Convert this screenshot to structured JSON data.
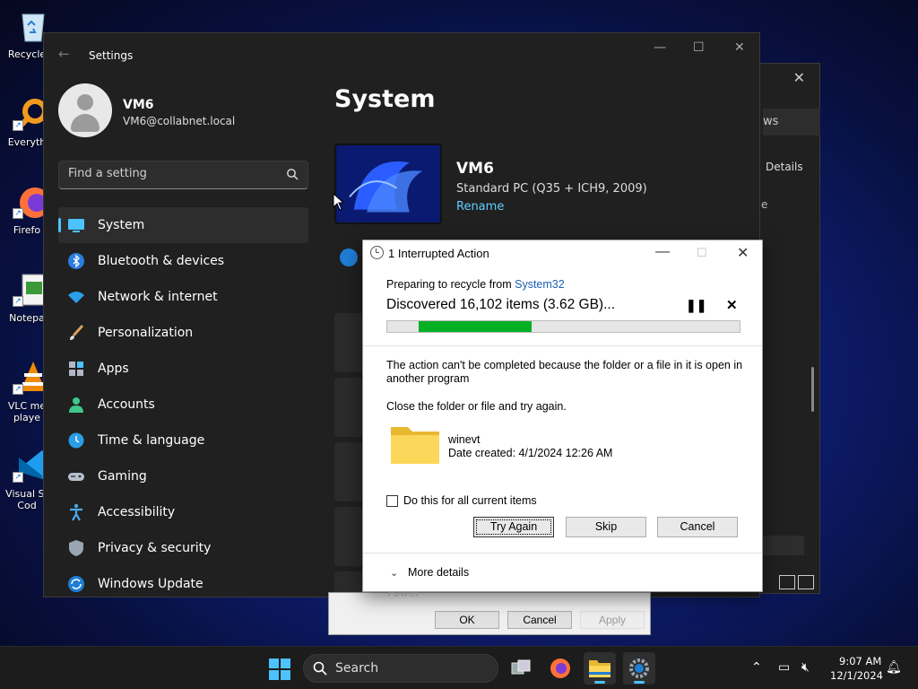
{
  "desktop": {
    "icons": [
      {
        "label": "Recycle",
        "icon": "recycle-bin-icon"
      },
      {
        "label": "Everyth",
        "icon": "everything-search-icon"
      },
      {
        "label": "Firefo",
        "icon": "firefox-icon"
      },
      {
        "label": "Notepa",
        "icon": "notepad-icon"
      },
      {
        "label": "VLC me\nplaye",
        "icon": "vlc-icon"
      },
      {
        "label": "Visual St\nCod",
        "icon": "vscode-icon"
      }
    ]
  },
  "bg_window": {
    "tab_label": "ws",
    "details_label": "Details",
    "partial_char": "e"
  },
  "settings": {
    "title": "Settings",
    "user": {
      "name": "VM6",
      "email": "VM6@collabnet.local"
    },
    "search_placeholder": "Find a setting",
    "nav": [
      {
        "label": "System",
        "icon": "monitor-icon",
        "active": true
      },
      {
        "label": "Bluetooth & devices",
        "icon": "bluetooth-icon"
      },
      {
        "label": "Network & internet",
        "icon": "wifi-icon"
      },
      {
        "label": "Personalization",
        "icon": "brush-icon"
      },
      {
        "label": "Apps",
        "icon": "apps-icon"
      },
      {
        "label": "Accounts",
        "icon": "person-icon"
      },
      {
        "label": "Time & language",
        "icon": "globe-clock-icon"
      },
      {
        "label": "Gaming",
        "icon": "gamepad-icon"
      },
      {
        "label": "Accessibility",
        "icon": "accessibility-icon"
      },
      {
        "label": "Privacy & security",
        "icon": "shield-icon"
      },
      {
        "label": "Windows Update",
        "icon": "update-icon"
      }
    ],
    "main": {
      "title": "System",
      "pc_name": "VM6",
      "pc_model": "Standard PC (Q35 + ICH9, 2009)",
      "rename_label": "Rename"
    }
  },
  "dialog": {
    "title": "1 Interrupted Action",
    "preparing_prefix": "Preparing to recycle from ",
    "preparing_source": "System32",
    "discovered": "Discovered 16,102 items (3.62 GB)...",
    "progress": {
      "start": 0.09,
      "end": 0.41,
      "color": "#06b025"
    },
    "message": "The action can't be completed because the folder or a file in it is open in another program",
    "instruction": "Close the folder or file and try again.",
    "file_name": "winevt",
    "file_date": "Date created: 4/1/2024 12:26 AM",
    "checkbox_label": "Do this for all current items",
    "buttons": {
      "try_again": "Try Again",
      "skip": "Skip",
      "cancel": "Cancel"
    },
    "more_details": "More details"
  },
  "properties_strip": {
    "power_label": "Power",
    "ok": "OK",
    "cancel": "Cancel",
    "apply": "Apply"
  },
  "taskbar": {
    "search_label": "Search",
    "time": "9:07 AM",
    "date": "12/1/2024",
    "accent": "#4cc2ff"
  }
}
